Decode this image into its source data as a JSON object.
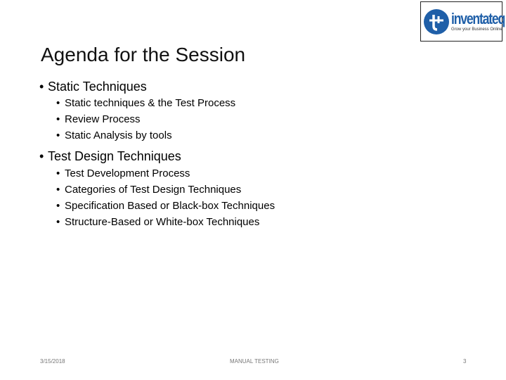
{
  "logo": {
    "name": "inventateq",
    "tagline": "Grow your Business Online",
    "brand_color": "#1f5fa8"
  },
  "slide": {
    "title": "Agenda for the Session",
    "sections": [
      {
        "heading": "Static Techniques",
        "items": [
          "Static techniques & the Test Process",
          "Review Process",
          "Static Analysis by tools"
        ]
      },
      {
        "heading": "Test Design Techniques",
        "items": [
          "Test Development Process",
          "Categories of Test Design Techniques",
          "Specification Based or Black-box Techniques",
          "Structure-Based or White-box Techniques"
        ]
      }
    ],
    "bullet": "•"
  },
  "footer": {
    "date": "3/15/2018",
    "center": "MANUAL TESTING",
    "page": "3"
  }
}
